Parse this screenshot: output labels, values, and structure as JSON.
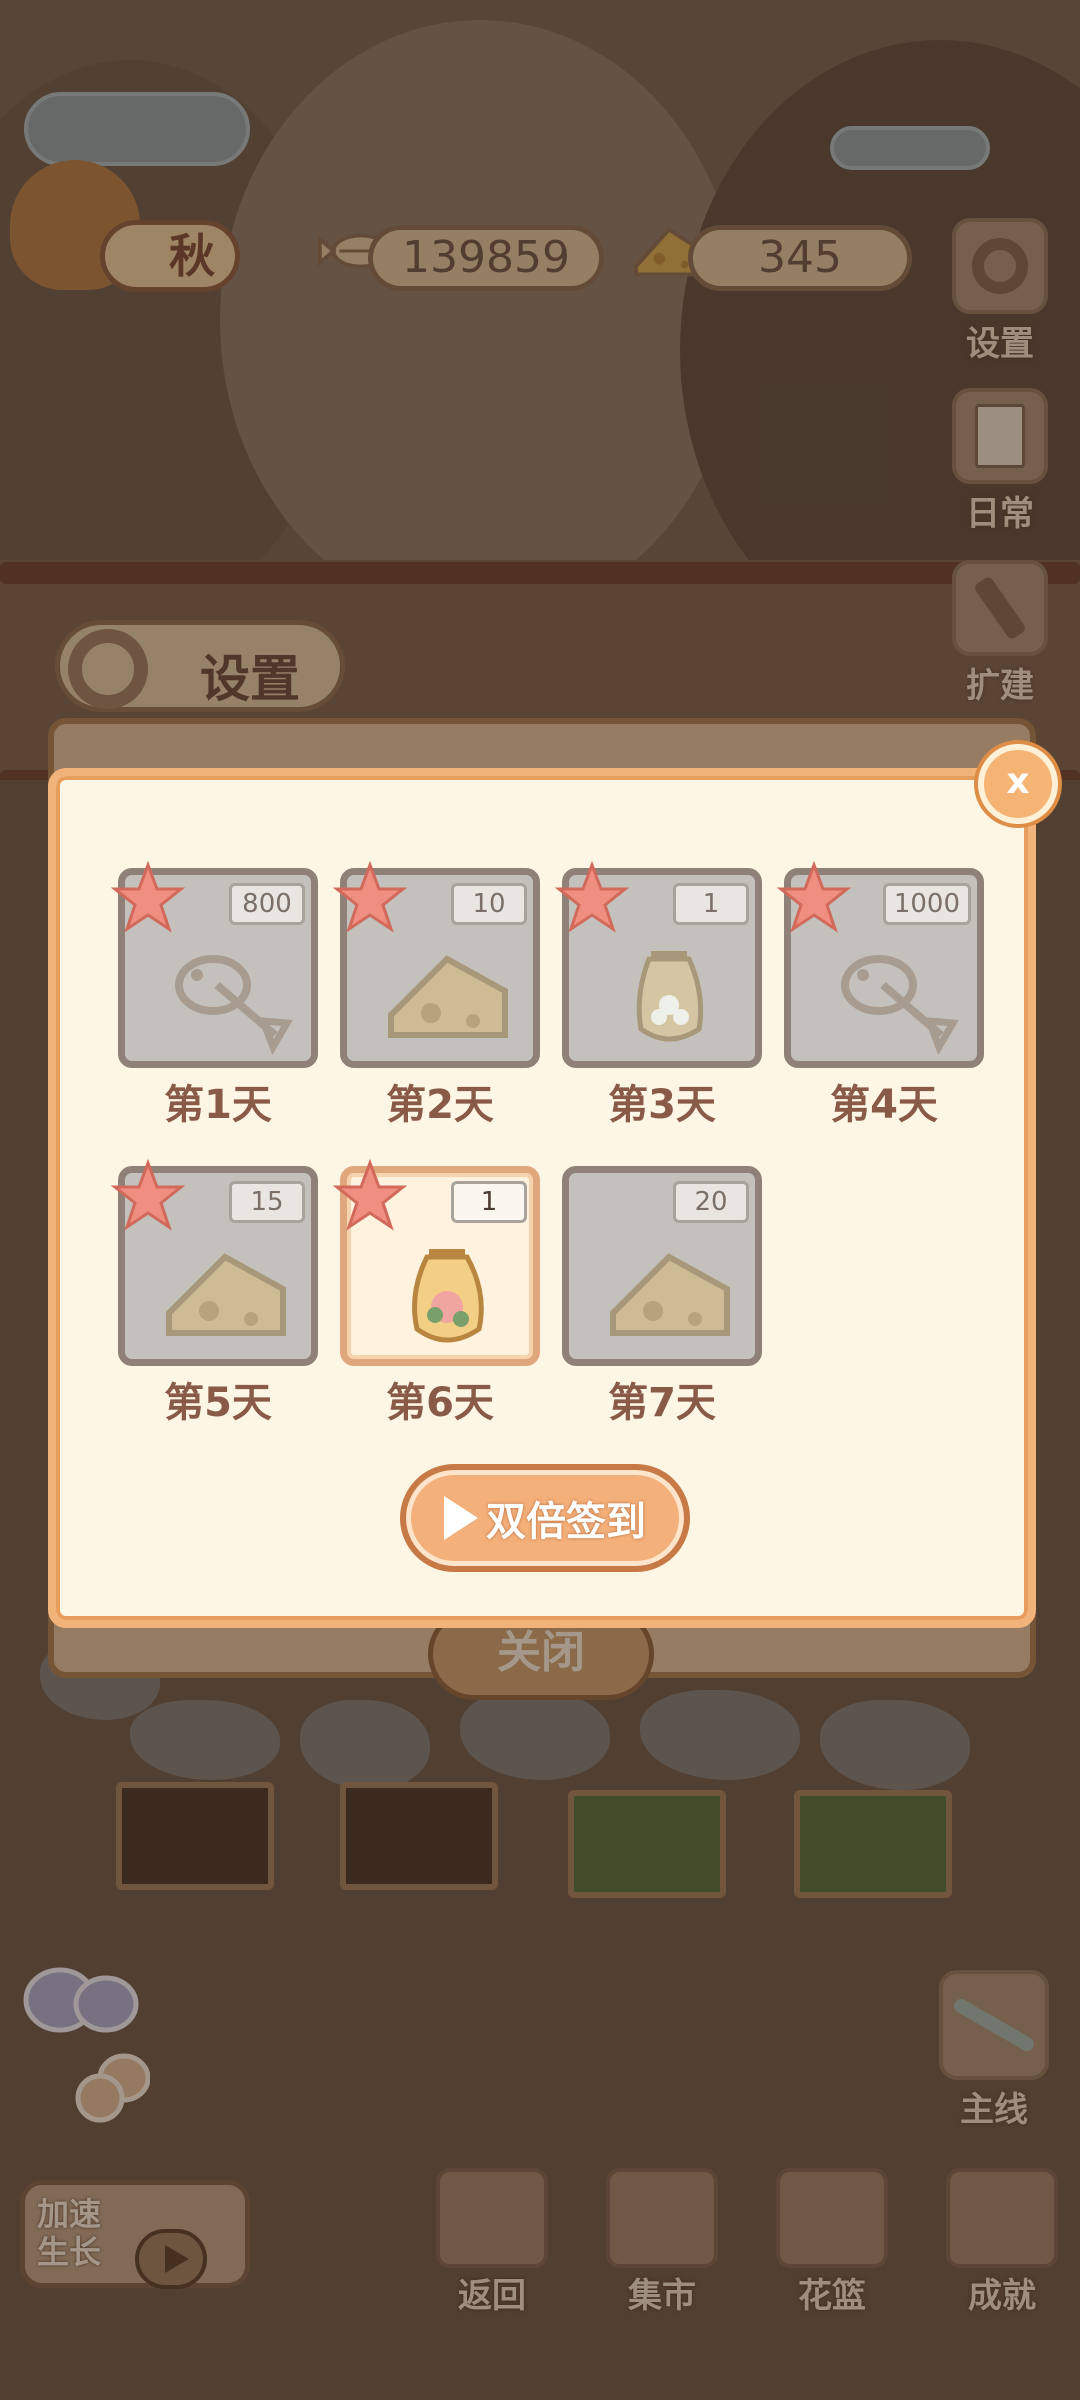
{
  "hud": {
    "season_label": "秋",
    "fish_count": "139859",
    "cheese_count": "345",
    "side_buttons": [
      {
        "id": "settings",
        "label": "设置",
        "icon": "gear-icon"
      },
      {
        "id": "daily",
        "label": "日常",
        "icon": "daily-note-icon"
      },
      {
        "id": "expand",
        "label": "扩建",
        "icon": "hammer-icon"
      },
      {
        "id": "mainline",
        "label": "主线",
        "icon": "dragonfly-icon"
      }
    ]
  },
  "background_panel": {
    "settings_label": "设置",
    "close_label": "关闭"
  },
  "modal": {
    "close_label": "x",
    "days": [
      {
        "label": "第1天",
        "amount": "800",
        "reward": "fish-bone-icon",
        "claimed": true
      },
      {
        "label": "第2天",
        "amount": "10",
        "reward": "cheese-icon",
        "claimed": true
      },
      {
        "label": "第3天",
        "amount": "1",
        "reward": "white-flower-seed-bag-icon",
        "claimed": true
      },
      {
        "label": "第4天",
        "amount": "1000",
        "reward": "fish-bone-icon",
        "claimed": true
      },
      {
        "label": "第5天",
        "amount": "15",
        "reward": "cheese-icon",
        "claimed": true
      },
      {
        "label": "第6天",
        "amount": "1",
        "reward": "pink-flower-seed-bag-icon",
        "claimed": true
      },
      {
        "label": "第7天",
        "amount": "20",
        "reward": "cheese-icon",
        "claimed": false
      }
    ],
    "double_signin_label": "双倍签到"
  },
  "bottom": {
    "speedup_label": "加速生长",
    "nav": [
      {
        "id": "back",
        "label": "返回"
      },
      {
        "id": "market",
        "label": "集市"
      },
      {
        "id": "basket",
        "label": "花篮"
      },
      {
        "id": "achievement",
        "label": "成就"
      }
    ]
  },
  "colors": {
    "modal_bg": "#fdf6e4",
    "modal_border": "#f2b37a",
    "accent_orange": "#f4b07a",
    "day_label": "#8a5a48"
  }
}
